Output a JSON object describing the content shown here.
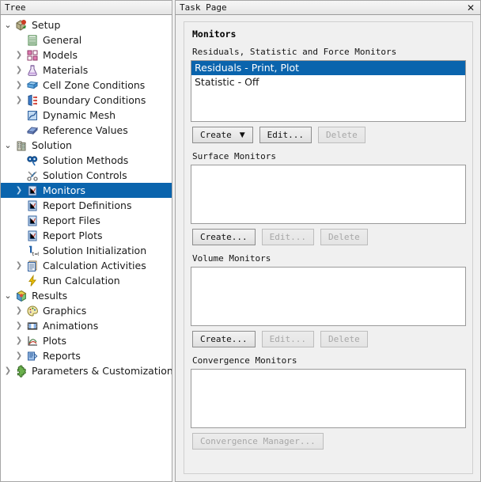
{
  "tree_panel": {
    "header_title": "Tree",
    "items": [
      {
        "label": "Setup",
        "level": 0,
        "twisty": "open",
        "icon": "setup-icon"
      },
      {
        "label": "General",
        "level": 1,
        "twisty": "none",
        "icon": "general-icon"
      },
      {
        "label": "Models",
        "level": 1,
        "twisty": "closed",
        "icon": "models-icon"
      },
      {
        "label": "Materials",
        "level": 1,
        "twisty": "closed",
        "icon": "materials-icon"
      },
      {
        "label": "Cell Zone Conditions",
        "level": 1,
        "twisty": "closed",
        "icon": "cell-zone-icon"
      },
      {
        "label": "Boundary Conditions",
        "level": 1,
        "twisty": "closed",
        "icon": "boundary-conditions-icon"
      },
      {
        "label": "Dynamic Mesh",
        "level": 1,
        "twisty": "none",
        "icon": "dynamic-mesh-icon"
      },
      {
        "label": "Reference Values",
        "level": 1,
        "twisty": "none",
        "icon": "reference-values-icon"
      },
      {
        "label": "Solution",
        "level": 0,
        "twisty": "open",
        "icon": "solution-icon"
      },
      {
        "label": "Solution Methods",
        "level": 1,
        "twisty": "none",
        "icon": "solution-methods-icon"
      },
      {
        "label": "Solution Controls",
        "level": 1,
        "twisty": "none",
        "icon": "solution-controls-icon"
      },
      {
        "label": "Monitors",
        "level": 1,
        "twisty": "closed",
        "icon": "monitors-icon",
        "selected": true
      },
      {
        "label": "Report Definitions",
        "level": 1,
        "twisty": "none",
        "icon": "report-icon"
      },
      {
        "label": "Report Files",
        "level": 1,
        "twisty": "none",
        "icon": "report-icon"
      },
      {
        "label": "Report Plots",
        "level": 1,
        "twisty": "none",
        "icon": "report-icon"
      },
      {
        "label": "Solution Initialization",
        "level": 1,
        "twisty": "none",
        "icon": "initialization-icon"
      },
      {
        "label": "Calculation Activities",
        "level": 1,
        "twisty": "closed",
        "icon": "calculation-activities-icon"
      },
      {
        "label": "Run Calculation",
        "level": 1,
        "twisty": "none",
        "icon": "run-calculation-icon"
      },
      {
        "label": "Results",
        "level": 0,
        "twisty": "open",
        "icon": "results-icon"
      },
      {
        "label": "Graphics",
        "level": 1,
        "twisty": "closed",
        "icon": "graphics-icon"
      },
      {
        "label": "Animations",
        "level": 1,
        "twisty": "closed",
        "icon": "animations-icon"
      },
      {
        "label": "Plots",
        "level": 1,
        "twisty": "closed",
        "icon": "plots-icon"
      },
      {
        "label": "Reports",
        "level": 1,
        "twisty": "closed",
        "icon": "reports-icon"
      },
      {
        "label": "Parameters & Customization",
        "level": 0,
        "twisty": "closed",
        "icon": "parameters-icon"
      }
    ]
  },
  "task_page": {
    "header_title": "Task Page",
    "close_label": "✕",
    "title": "Monitors",
    "sections": [
      {
        "label": "Residuals, Statistic and Force Monitors",
        "items": [
          {
            "text": "Residuals - Print, Plot",
            "selected": true
          },
          {
            "text": "Statistic - Off",
            "selected": false
          }
        ],
        "buttons": [
          {
            "label": "Create",
            "caret": "▼",
            "disabled": false
          },
          {
            "label": "Edit...",
            "disabled": false
          },
          {
            "label": "Delete",
            "disabled": true
          }
        ]
      },
      {
        "label": "Surface Monitors",
        "items": [],
        "buttons": [
          {
            "label": "Create...",
            "disabled": false
          },
          {
            "label": "Edit...",
            "disabled": true
          },
          {
            "label": "Delete",
            "disabled": true
          }
        ]
      },
      {
        "label": "Volume Monitors",
        "items": [],
        "buttons": [
          {
            "label": "Create...",
            "disabled": false
          },
          {
            "label": "Edit...",
            "disabled": true
          },
          {
            "label": "Delete",
            "disabled": true
          }
        ]
      },
      {
        "label": "Convergence Monitors",
        "items": [],
        "buttons": [
          {
            "label": "Convergence Manager...",
            "disabled": true
          }
        ]
      }
    ]
  },
  "colors": {
    "selection_blue": "#0a64ad",
    "panel_bg": "#f0f0f0",
    "listbox_bg": "#ffffff",
    "border": "#a6a6a6"
  }
}
